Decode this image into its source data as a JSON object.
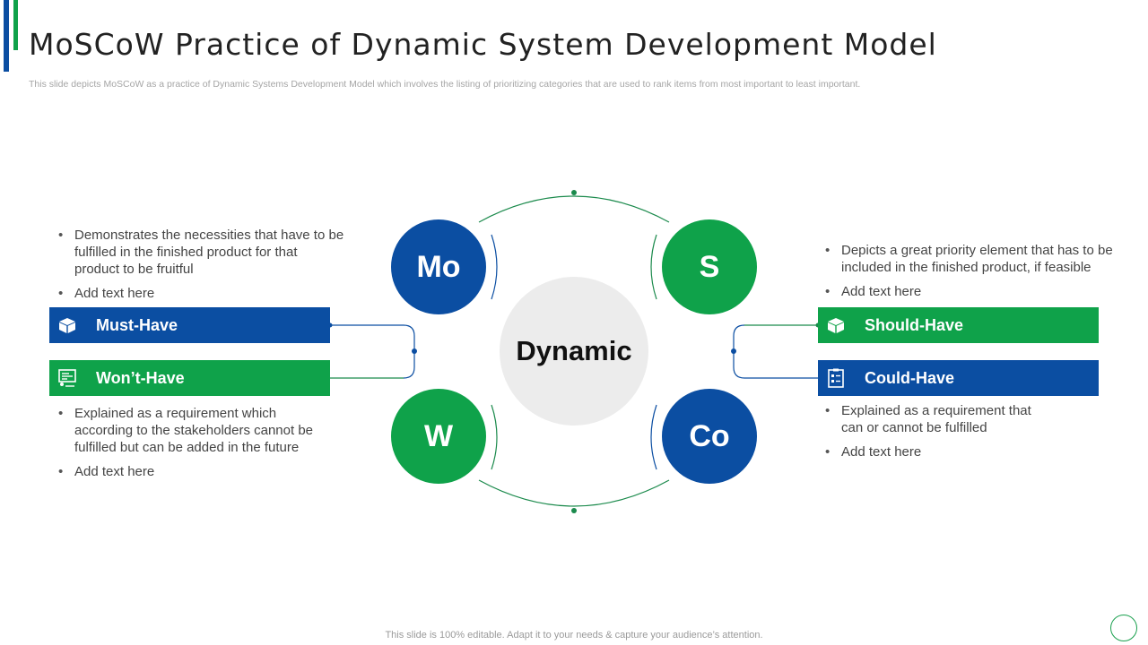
{
  "slide": {
    "title": "MoSCoW Practice of Dynamic System Development Model",
    "subtitle": "This slide depicts MoSCoW as a practice of Dynamic Systems Development Model which involves the listing of prioritizing categories that are used to rank items from most important to least important.",
    "footer": "This slide is 100% editable. Adapt it to your needs & capture your audience’s attention."
  },
  "diagram": {
    "center": "Dynamic",
    "circles": {
      "mo": "Mo",
      "s": "S",
      "w": "W",
      "co": "Co"
    },
    "must_have": {
      "label": "Must-Have",
      "icon": "box-icon",
      "bullets": [
        "Demonstrates the necessities that have to be fulfilled in the finished product for that product to be fruitful",
        "Add text here"
      ]
    },
    "wont_have": {
      "label": "Won’t-Have",
      "icon": "presentation-board-icon",
      "bullets": [
        "Explained as a requirement which according to the stakeholders cannot be fulfilled but can be added in the future",
        "Add text here"
      ]
    },
    "should_have": {
      "label": "Should-Have",
      "icon": "box-icon",
      "bullets": [
        "Depicts a great priority element that has to be included in the finished product, if feasible",
        "Add text here"
      ]
    },
    "could_have": {
      "label": "Could-Have",
      "icon": "clipboard-checklist-icon",
      "bullets": [
        "Explained as a requirement that can or cannot be fulfilled",
        "Add text here"
      ]
    }
  },
  "colors": {
    "blue": "#0b4ea2",
    "green": "#0fa24a",
    "center_gray": "#ececec"
  }
}
